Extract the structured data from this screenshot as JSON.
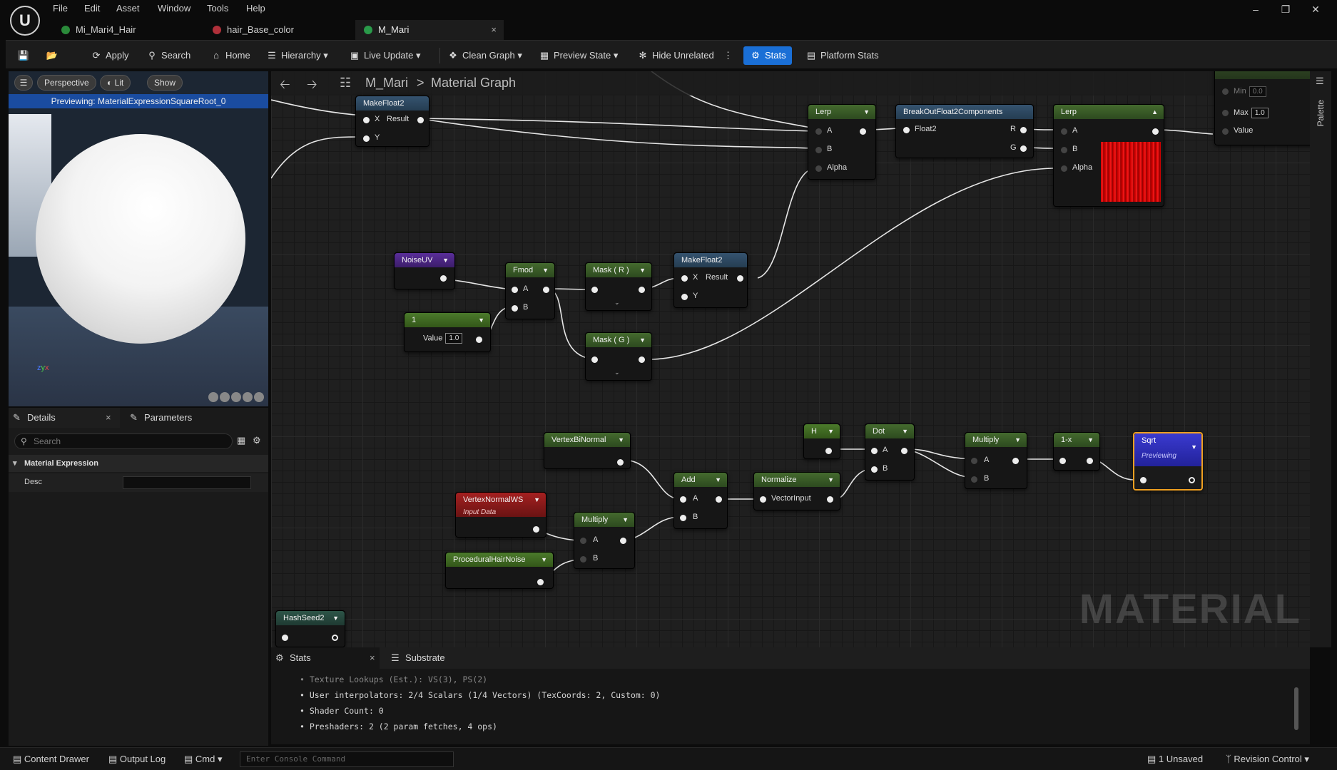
{
  "menu": [
    "File",
    "Edit",
    "Asset",
    "Window",
    "Tools",
    "Help"
  ],
  "tabs": [
    {
      "label": "Mi_Mari4_Hair",
      "color": "#2a8a3a"
    },
    {
      "label": "hair_Base_color",
      "color": "#b0303a"
    },
    {
      "label": "M_Mari",
      "color": "#2a9a4a",
      "close": "×"
    }
  ],
  "toolbar": {
    "apply": "Apply",
    "search": "Search",
    "home": "Home",
    "hierarchy": "Hierarchy",
    "live_update": "Live Update",
    "clean_graph": "Clean Graph",
    "preview_state": "Preview State",
    "hide_unrelated": "Hide Unrelated",
    "stats": "Stats",
    "platform_stats": "Platform Stats"
  },
  "viewport": {
    "perspective": "Perspective",
    "lit": "Lit",
    "show": "Show",
    "status": "Previewing: MaterialExpressionSquareRoot_0"
  },
  "details": {
    "tab_details": "Details",
    "tab_parameters": "Parameters",
    "close": "×",
    "search_placeholder": "Search",
    "section": "Material Expression",
    "prop_desc": "Desc"
  },
  "graph": {
    "breadcrumb_root": "M_Mari",
    "breadcrumb_sep": ">",
    "breadcrumb_leaf": "Material Graph",
    "watermark": "MATERIAL",
    "nodes": {
      "makefloat2_top": {
        "title": "MakeFloat2",
        "x": "X",
        "result": "Result",
        "y": "Y"
      },
      "lerp1": {
        "title": "Lerp",
        "a": "A",
        "b": "B",
        "alpha": "Alpha"
      },
      "breakout": {
        "title": "BreakOutFloat2Components",
        "float2": "Float2",
        "r": "R",
        "g": "G"
      },
      "lerp2": {
        "title": "Lerp",
        "a": "A",
        "b": "B",
        "alpha": "Alpha"
      },
      "smoothstep": {
        "min": "Min",
        "min_val": "0.0",
        "max": "Max",
        "max_val": "1.0",
        "value": "Value"
      },
      "noiseuv": {
        "title": "NoiseUV"
      },
      "fmod": {
        "title": "Fmod",
        "a": "A",
        "b": "B"
      },
      "maskr": {
        "title": "Mask ( R )"
      },
      "maskg": {
        "title": "Mask ( G )"
      },
      "makefloat2_mid": {
        "title": "MakeFloat2",
        "x": "X",
        "result": "Result",
        "y": "Y"
      },
      "const1": {
        "title": "1",
        "value": "Value",
        "value_val": "1.0"
      },
      "vertexbinormal": {
        "title": "VertexBiNormal"
      },
      "vertexnormalws": {
        "title": "VertexNormalWS",
        "subtitle": "Input Data"
      },
      "multiply1": {
        "title": "Multiply",
        "a": "A",
        "b": "B"
      },
      "proceduralhairnoise": {
        "title": "ProceduralHairNoise"
      },
      "add": {
        "title": "Add",
        "a": "A",
        "b": "B"
      },
      "normalize": {
        "title": "Normalize",
        "input": "VectorInput"
      },
      "h": {
        "title": "H"
      },
      "dot": {
        "title": "Dot",
        "a": "A",
        "b": "B"
      },
      "multiply2": {
        "title": "Multiply",
        "a": "A",
        "b": "B"
      },
      "oneminus": {
        "title": "1-x"
      },
      "sqrt": {
        "title": "Sqrt",
        "subtitle": "Previewing"
      },
      "hashseed2": {
        "title": "HashSeed2"
      }
    }
  },
  "palette_label": "Palette",
  "stats": {
    "tab_stats": "Stats",
    "tab_substrate": "Substrate",
    "close": "×",
    "lines": [
      "Texture Lookups (Est.): VS(3), PS(2)",
      "User interpolators: 2/4 Scalars (1/4 Vectors) (TexCoords: 2, Custom: 0)",
      "Shader Count: 0",
      "Preshaders: 2  (2 param fetches, 4 ops)"
    ]
  },
  "statusbar": {
    "content_drawer": "Content Drawer",
    "output_log": "Output Log",
    "cmd": "Cmd",
    "console_placeholder": "Enter Console Command",
    "unsaved": "1 Unsaved",
    "revision_control": "Revision Control"
  }
}
